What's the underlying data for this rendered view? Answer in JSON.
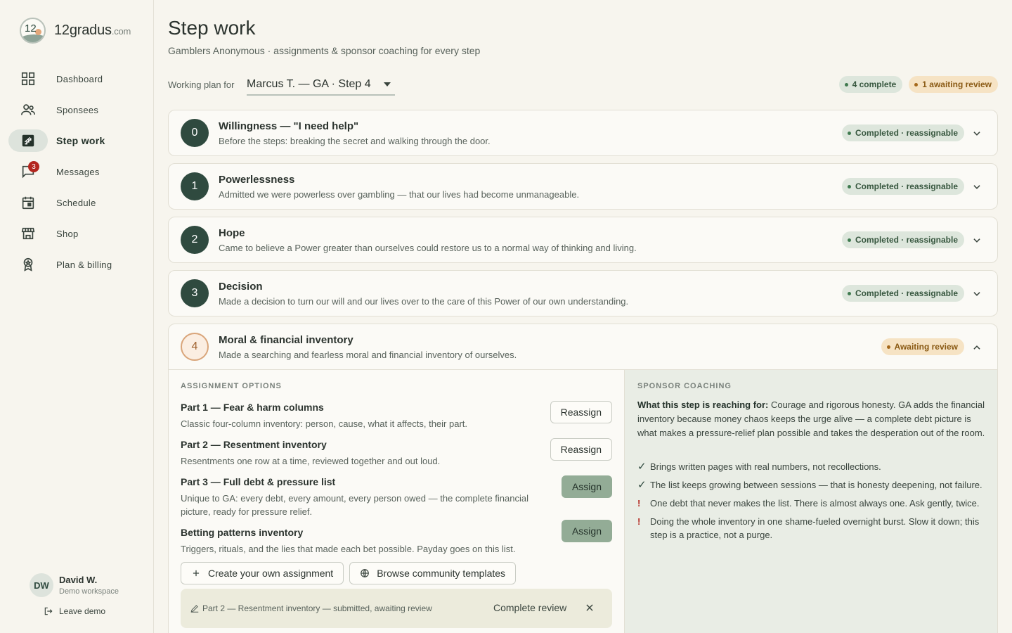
{
  "brand": {
    "logo_text": "12",
    "name": "12gradus",
    "domain": ".com"
  },
  "nav": {
    "items": [
      {
        "label": "Dashboard",
        "icon": "grid-icon"
      },
      {
        "label": "Sponsees",
        "icon": "people-icon"
      },
      {
        "label": "Step work",
        "icon": "stairs-icon",
        "active": true
      },
      {
        "label": "Messages",
        "icon": "chat-icon",
        "badge": "3"
      },
      {
        "label": "Schedule",
        "icon": "calendar-icon"
      },
      {
        "label": "Shop",
        "icon": "store-icon"
      },
      {
        "label": "Plan & billing",
        "icon": "award-icon"
      }
    ]
  },
  "user": {
    "initials": "DW",
    "name": "David W.",
    "workspace": "Demo workspace",
    "leave_label": "Leave demo"
  },
  "header": {
    "title": "Step work",
    "subtitle": "Gamblers Anonymous · assignments & sponsor coaching for every step",
    "plan_label": "Working plan for",
    "plan_value": "Marcus T. — GA · Step 4",
    "complete_chip": "4 complete",
    "awaiting_chip": "1 awaiting review"
  },
  "steps": [
    {
      "num": "0",
      "title": "Willingness — \"I need help\"",
      "desc": "Before the steps: breaking the secret and walking through the door.",
      "status": "Completed · reassignable"
    },
    {
      "num": "1",
      "title": "Powerlessness",
      "desc": "Admitted we were powerless over gambling — that our lives had become unmanageable.",
      "status": "Completed · reassignable"
    },
    {
      "num": "2",
      "title": "Hope",
      "desc": "Came to believe a Power greater than ourselves could restore us to a normal way of thinking and living.",
      "status": "Completed · reassignable"
    },
    {
      "num": "3",
      "title": "Decision",
      "desc": "Made a decision to turn our will and our lives over to the care of this Power of our own understanding.",
      "status": "Completed · reassignable"
    },
    {
      "num": "4",
      "title": "Moral & financial inventory",
      "desc": "Made a searching and fearless moral and financial inventory of ourselves.",
      "status": "Awaiting review"
    }
  ],
  "assignment": {
    "heading": "ASSIGNMENT OPTIONS",
    "options": [
      {
        "title": "Part 1 — Fear & harm columns",
        "desc": "Classic four-column inventory: person, cause, what it affects, their part.",
        "button": "Reassign"
      },
      {
        "title": "Part 2 — Resentment inventory",
        "desc": "Resentments one row at a time, reviewed together and out loud.",
        "button": "Reassign"
      },
      {
        "title": "Part 3 — Full debt & pressure list",
        "desc": "Unique to GA: every debt, every amount, every person owed — the complete financial picture, ready for pressure relief.",
        "button": "Assign"
      },
      {
        "title": "Betting patterns inventory",
        "desc": "Triggers, rituals, and the lies that made each bet possible. Payday goes on this list.",
        "button": "Assign"
      }
    ],
    "create_label": "Create your own assignment",
    "browse_label": "Browse community templates",
    "notice_text": "Part 2 — Resentment inventory — submitted, awaiting review",
    "notice_action": "Complete review"
  },
  "coaching": {
    "heading": "SPONSOR COACHING",
    "lead_strong": "What this step is reaching for:",
    "lead_text": " Courage and rigorous honesty. GA adds the financial inventory because money chaos keeps the urge alive — a complete debt picture is what makes a pressure-relief plan possible and takes the desperation out of the room.",
    "tips": [
      {
        "mark": "✓",
        "kind": "ok",
        "text": "Brings written pages with real numbers, not recollections."
      },
      {
        "mark": "✓",
        "kind": "ok",
        "text": "The list keeps growing between sessions — that is honesty deepening, not failure."
      },
      {
        "mark": "!",
        "kind": "warn",
        "text": "One debt that never makes the list. There is almost always one. Ask gently, twice."
      },
      {
        "mark": "!",
        "kind": "warn",
        "text": "Doing the whole inventory in one shame-fueled overnight burst. Slow it down; this step is a practice, not a purge."
      }
    ]
  },
  "colors": {
    "accent": "#2f4a3f",
    "complete_chip": "#dde6dc",
    "awaiting_chip": "#f6e3c4",
    "assign_button": "#93ac96",
    "badge": "#b3261e"
  }
}
